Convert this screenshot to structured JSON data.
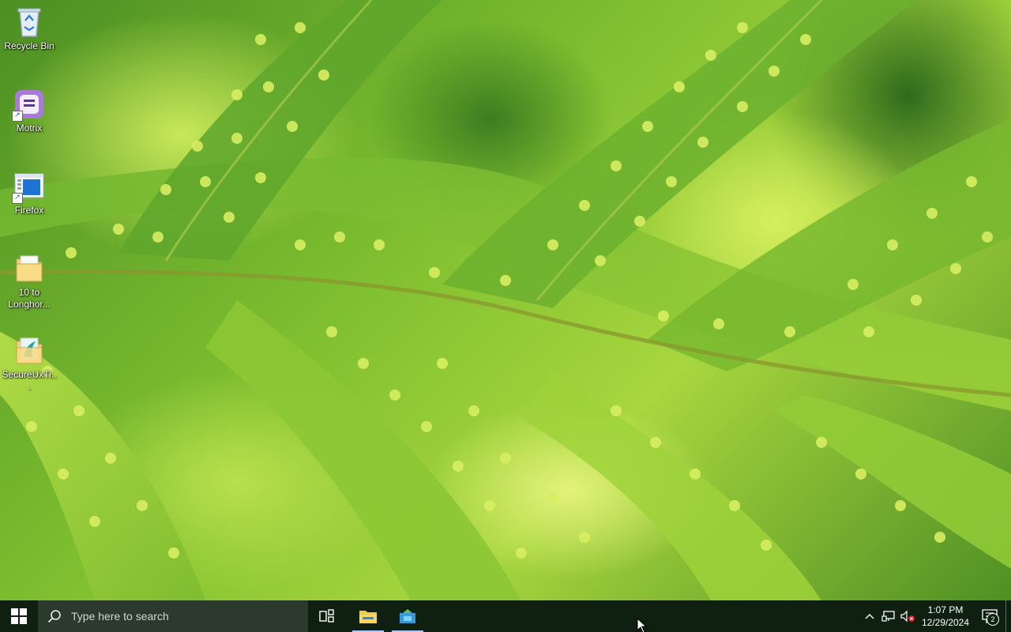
{
  "desktop": {
    "icons": [
      {
        "label": "Recycle Bin",
        "icon": "recycle-bin-icon"
      },
      {
        "label": "Motrix",
        "icon": "motrix-icon"
      },
      {
        "label": "Firefox",
        "icon": "firefox-shortcut-icon"
      },
      {
        "label": "10 to Longhor...",
        "icon": "folder-icon"
      },
      {
        "label": "SecureUxTi...",
        "icon": "secureux-folder-icon"
      }
    ]
  },
  "taskbar": {
    "search_placeholder": "Type here to search",
    "pinned": [
      {
        "name": "Task View",
        "icon": "task-view-icon"
      },
      {
        "name": "File Explorer",
        "icon": "file-explorer-icon",
        "active": true
      },
      {
        "name": "App Installer",
        "icon": "app-installer-icon",
        "active": true
      }
    ],
    "tray": {
      "icons": [
        "chevron-up-icon",
        "network-icon",
        "volume-muted-icon"
      ],
      "time": "1:07 PM",
      "date": "12/29/2024",
      "notification_count": "2"
    }
  },
  "colors": {
    "taskbar_bg": "#0f1f10",
    "search_bg": "#2b3a2c",
    "active_indicator": "#a9c6ff"
  }
}
